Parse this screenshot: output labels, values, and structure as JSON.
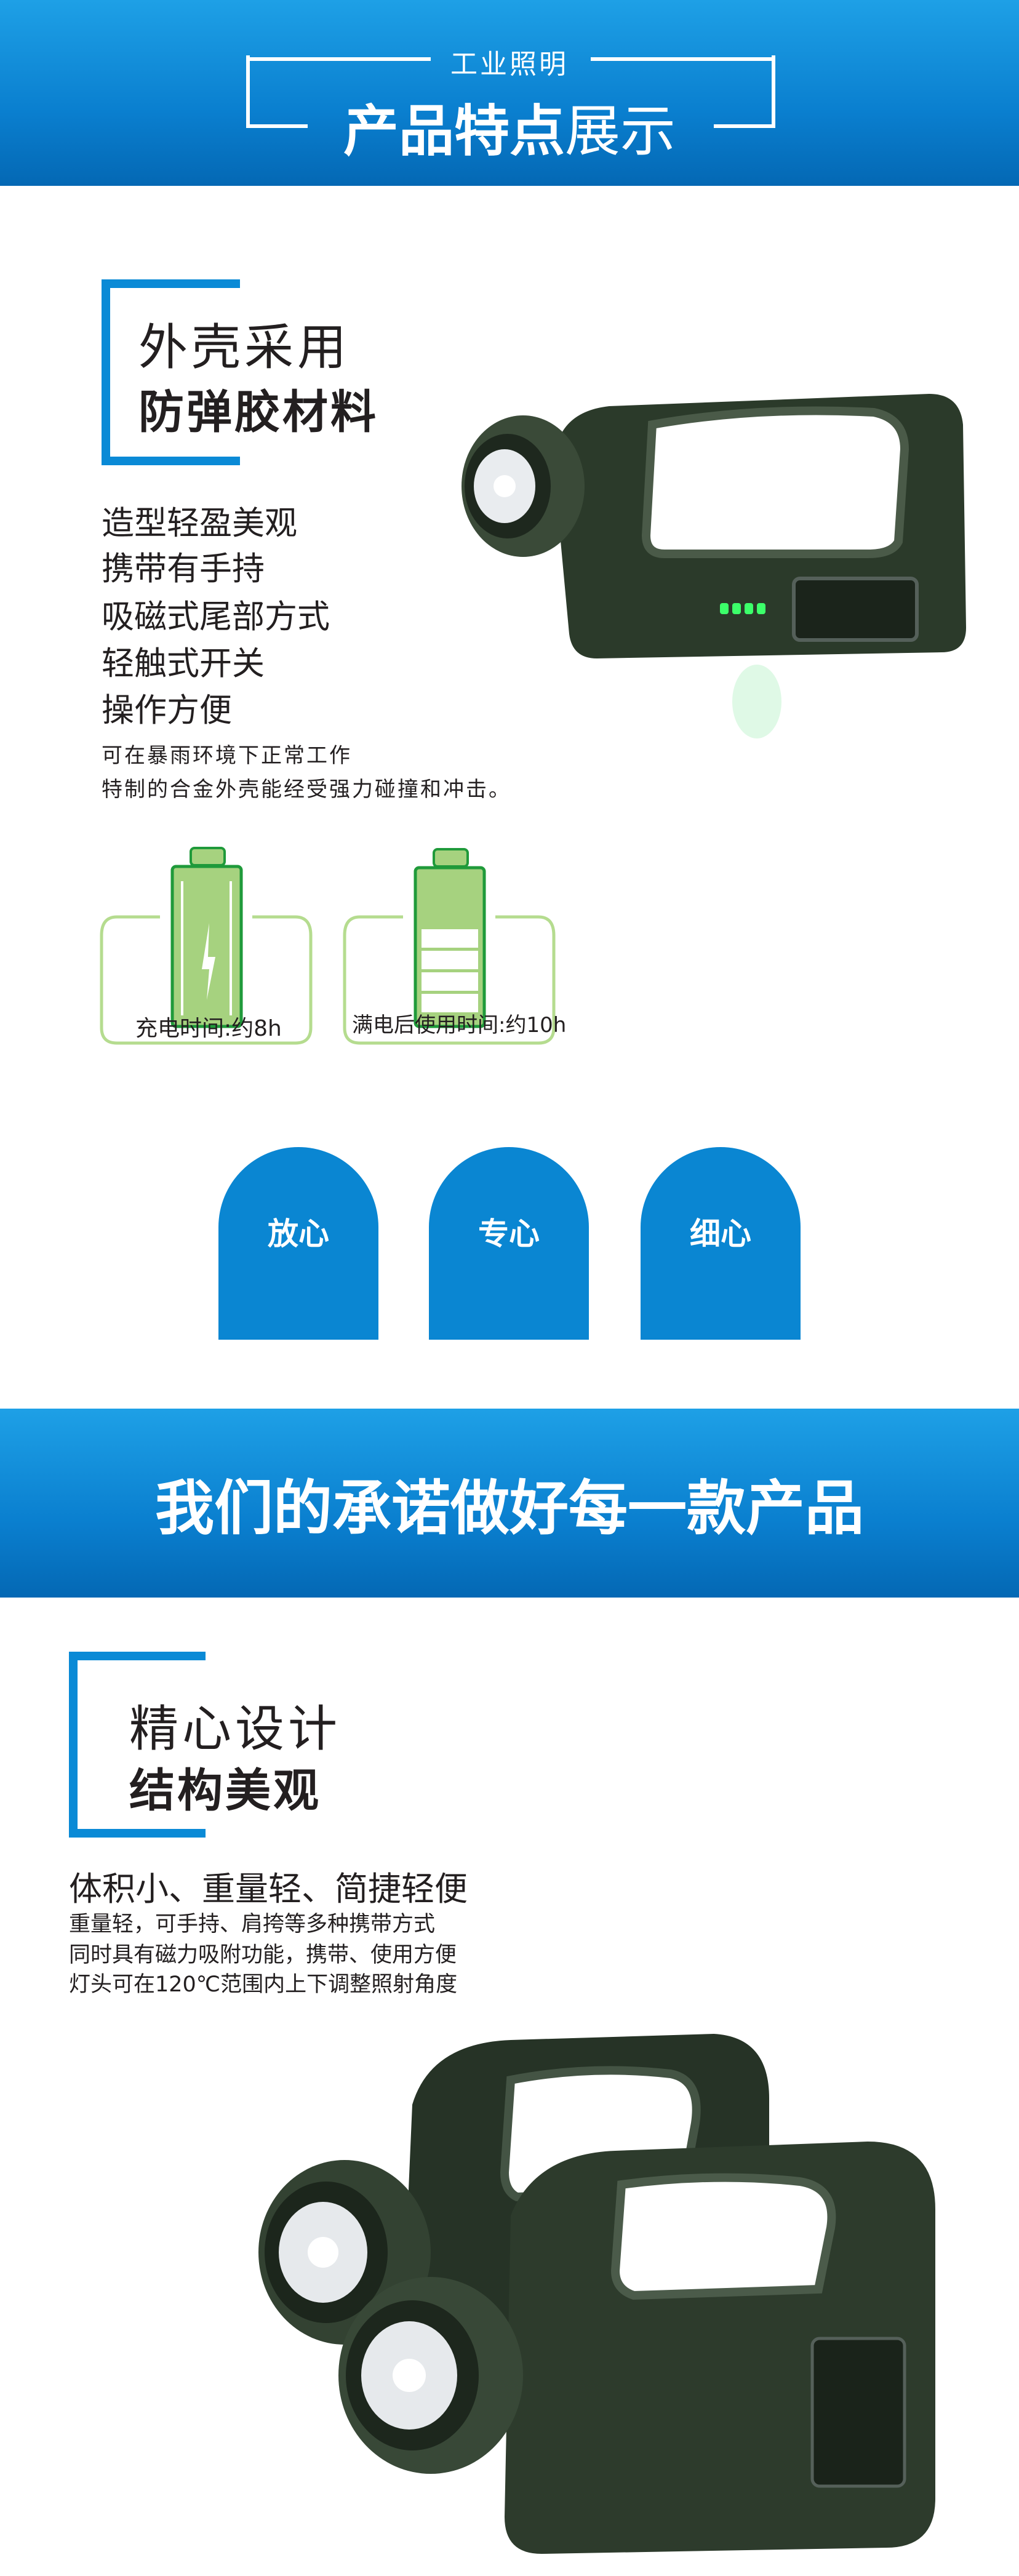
{
  "header": {
    "subtitle": "工业照明",
    "title_bold": "产品特点",
    "title_rest": "展示"
  },
  "section1": {
    "heading_light": "外壳采用",
    "heading_bold": "防弹胶材料",
    "features": [
      "造型轻盈美观",
      "携带有手持",
      "吸磁式尾部方式",
      "轻触式开关",
      "操作方便"
    ],
    "notes": [
      "可在暴雨环境下正常工作",
      "特制的合金外壳能经受强力碰撞和冲击。"
    ]
  },
  "battery": {
    "charge_label": "充电时间:约8h",
    "usage_label": "满电后使用时间:约10h"
  },
  "pills": [
    "放心",
    "专心",
    "细心"
  ],
  "banner": {
    "text": "我们的承诺做好每一款产品"
  },
  "section2": {
    "heading_light": "精心设计",
    "heading_bold": "结构美观",
    "lead": "体积小、重量轻、简捷轻便",
    "notes": [
      "重量轻，可手持、肩挎等多种携带方式",
      "同时具有磁力吸附功能，携带、使用方便",
      "灯头可在120℃范围内上下调整照射角度"
    ]
  },
  "colors": {
    "brand_blue": "#0a86d2",
    "battery_green": "#1f9a3a",
    "battery_fill": "#a6d27f",
    "outline_green": "#b5dc8f"
  }
}
